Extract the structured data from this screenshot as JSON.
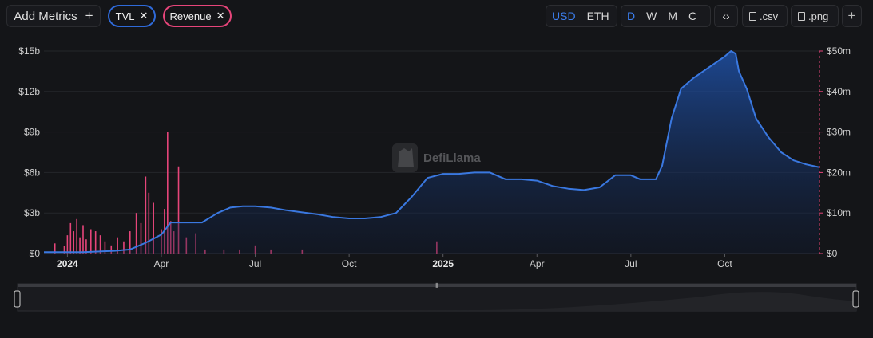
{
  "toolbar": {
    "add_metrics_label": "Add Metrics",
    "metrics": [
      {
        "label": "TVL",
        "color": "#2f6ad9"
      },
      {
        "label": "Revenue",
        "color": "#e6457a"
      }
    ],
    "currency": [
      "USD",
      "ETH"
    ],
    "currency_active": "USD",
    "granularity": [
      "D",
      "W",
      "M",
      "C"
    ],
    "granularity_active": "D",
    "embed_icon": "code-icon",
    "csv_label": ".csv",
    "png_label": ".png"
  },
  "watermark": "DefiLlama",
  "chart_data": {
    "type": "area",
    "x_tick_labels": [
      {
        "label": "2024",
        "bold": true,
        "t": 6
      },
      {
        "label": "Apr",
        "bold": false,
        "t": 9
      },
      {
        "label": "Jul",
        "bold": false,
        "t": 12
      },
      {
        "label": "Oct",
        "bold": false,
        "t": 15
      },
      {
        "label": "2025",
        "bold": true,
        "t": 18
      },
      {
        "label": "Apr",
        "bold": false,
        "t": 21
      },
      {
        "label": "Jul",
        "bold": false,
        "t": 24
      },
      {
        "label": "Oct",
        "bold": false,
        "t": 27
      }
    ],
    "x_range_months": [
      5.25,
      30.0
    ],
    "left_axis": {
      "ticks": [
        "$0",
        "$3b",
        "$6b",
        "$9b",
        "$12b",
        "$15b"
      ],
      "values": [
        0,
        3,
        6,
        9,
        12,
        15
      ],
      "unit": "b",
      "ylim": [
        0,
        15
      ]
    },
    "right_axis": {
      "ticks": [
        "$0",
        "$10m",
        "$20m",
        "$30m",
        "$40m",
        "$50m"
      ],
      "values": [
        0,
        10,
        20,
        30,
        40,
        50
      ],
      "unit": "m",
      "ylim": [
        0,
        50
      ]
    },
    "grid": true,
    "series": [
      {
        "name": "TVL",
        "axis": "left",
        "color": "#3a78e0",
        "points": [
          [
            5.25,
            0.1
          ],
          [
            6.5,
            0.1
          ],
          [
            7.5,
            0.2
          ],
          [
            8.0,
            0.3
          ],
          [
            8.5,
            0.8
          ],
          [
            9.0,
            1.4
          ],
          [
            9.3,
            2.3
          ],
          [
            9.8,
            2.3
          ],
          [
            10.3,
            2.3
          ],
          [
            10.8,
            3.0
          ],
          [
            11.2,
            3.4
          ],
          [
            11.6,
            3.5
          ],
          [
            12.0,
            3.5
          ],
          [
            12.5,
            3.4
          ],
          [
            13.0,
            3.2
          ],
          [
            14.0,
            2.9
          ],
          [
            14.5,
            2.7
          ],
          [
            15.0,
            2.6
          ],
          [
            15.5,
            2.6
          ],
          [
            16.0,
            2.7
          ],
          [
            16.5,
            3.0
          ],
          [
            17.0,
            4.2
          ],
          [
            17.5,
            5.6
          ],
          [
            18.0,
            5.9
          ],
          [
            18.5,
            5.9
          ],
          [
            19.0,
            6.0
          ],
          [
            19.5,
            6.0
          ],
          [
            20.0,
            5.5
          ],
          [
            20.5,
            5.5
          ],
          [
            21.0,
            5.4
          ],
          [
            21.5,
            5.0
          ],
          [
            22.0,
            4.8
          ],
          [
            22.5,
            4.7
          ],
          [
            23.0,
            4.9
          ],
          [
            23.5,
            5.8
          ],
          [
            24.0,
            5.8
          ],
          [
            24.3,
            5.5
          ],
          [
            24.8,
            5.5
          ],
          [
            25.0,
            6.5
          ],
          [
            25.3,
            10.0
          ],
          [
            25.6,
            12.2
          ],
          [
            26.0,
            13.0
          ],
          [
            26.5,
            13.8
          ],
          [
            27.0,
            14.6
          ],
          [
            27.2,
            15.0
          ],
          [
            27.35,
            14.8
          ],
          [
            27.45,
            13.5
          ],
          [
            27.7,
            12.2
          ],
          [
            28.0,
            10.0
          ],
          [
            28.4,
            8.6
          ],
          [
            28.8,
            7.5
          ],
          [
            29.2,
            6.9
          ],
          [
            29.6,
            6.6
          ],
          [
            30.0,
            6.4
          ]
        ]
      },
      {
        "name": "Revenue",
        "axis": "right",
        "color": "#e6457a",
        "bars": [
          [
            5.6,
            2.5
          ],
          [
            5.9,
            1.8
          ],
          [
            6.0,
            4.5
          ],
          [
            6.1,
            7.5
          ],
          [
            6.2,
            5.5
          ],
          [
            6.3,
            8.5
          ],
          [
            6.4,
            4.0
          ],
          [
            6.5,
            7.0
          ],
          [
            6.6,
            3.5
          ],
          [
            6.75,
            6.0
          ],
          [
            6.9,
            5.5
          ],
          [
            7.05,
            4.5
          ],
          [
            7.2,
            3.0
          ],
          [
            7.4,
            2.0
          ],
          [
            7.6,
            4.0
          ],
          [
            7.8,
            3.0
          ],
          [
            8.0,
            5.5
          ],
          [
            8.2,
            10.0
          ],
          [
            8.35,
            7.5
          ],
          [
            8.5,
            19.0
          ],
          [
            8.6,
            15.0
          ],
          [
            8.75,
            12.5
          ],
          [
            9.0,
            6.0
          ],
          [
            9.1,
            11.0
          ],
          [
            9.2,
            30.0
          ],
          [
            9.3,
            8.0
          ],
          [
            9.4,
            5.5
          ],
          [
            9.55,
            21.5
          ],
          [
            9.8,
            4.0
          ],
          [
            10.1,
            5.0
          ],
          [
            10.4,
            1.0
          ],
          [
            11.0,
            1.0
          ],
          [
            11.5,
            1.0
          ],
          [
            12.0,
            2.0
          ],
          [
            12.5,
            1.0
          ],
          [
            13.5,
            1.0
          ],
          [
            17.8,
            3.0
          ]
        ]
      }
    ]
  }
}
